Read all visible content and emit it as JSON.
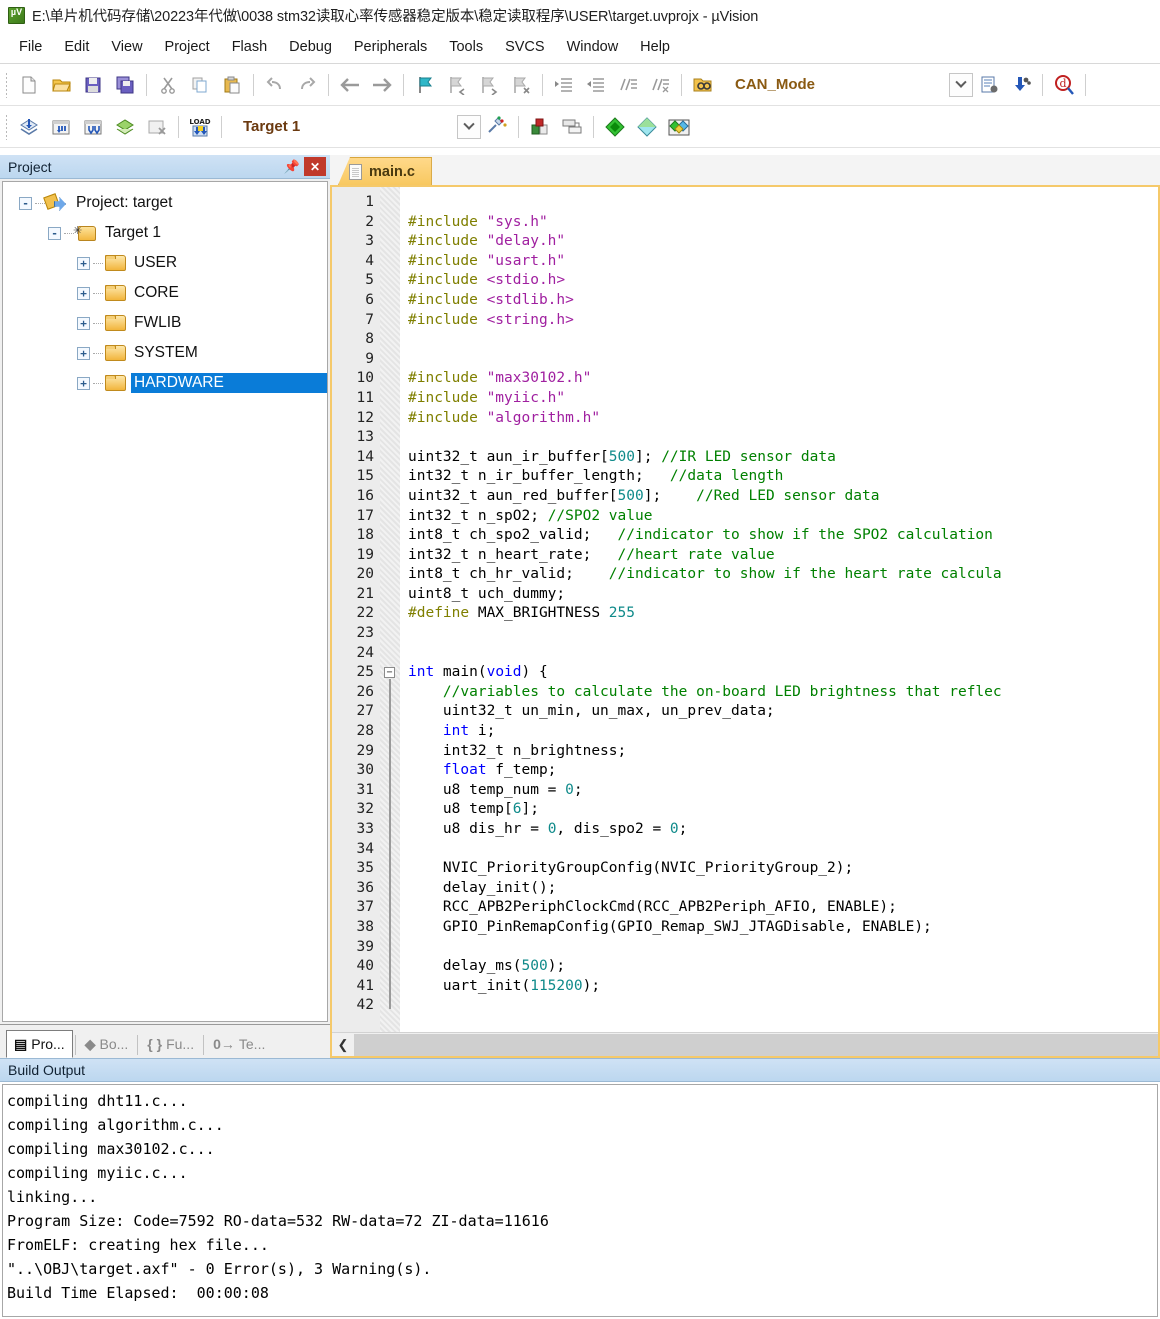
{
  "window": {
    "title": "E:\\单片机代码存储\\20223年代做\\0038 stm32读取心率传感器稳定版本\\稳定读取程序\\USER\\target.uvprojx - µVision",
    "app_icon": "uvision-icon"
  },
  "menu": {
    "items": [
      "File",
      "Edit",
      "View",
      "Project",
      "Flash",
      "Debug",
      "Peripherals",
      "Tools",
      "SVCS",
      "Window",
      "Help"
    ]
  },
  "toolbar1": {
    "buttons": [
      "new-file-icon",
      "open-file-icon",
      "save-icon",
      "save-all-icon",
      "cut-icon",
      "copy-icon",
      "paste-icon",
      "undo-icon",
      "redo-icon",
      "navigate-back-icon",
      "navigate-forward-icon",
      "bookmark-toggle-icon",
      "bookmark-prev-icon",
      "bookmark-next-icon",
      "bookmark-clear-icon",
      "indent-icon",
      "outdent-icon",
      "comment-icon",
      "uncomment-icon",
      "open-folder-icon"
    ],
    "combo_value": "CAN_Mode",
    "right_buttons": [
      "configure-icon",
      "download-icon",
      "find-in-files-icon"
    ]
  },
  "toolbar2": {
    "buttons": [
      "translate-icon",
      "build-icon",
      "rebuild-icon",
      "batch-build-icon",
      "stop-build-icon",
      "load-icon"
    ],
    "combo_value": "Target 1",
    "right_buttons": [
      "target-options-icon",
      "manage-runtime-icon",
      "debug-start-icon",
      "debug-stop-icon",
      "multi-project-icon"
    ]
  },
  "project_panel": {
    "title": "Project",
    "pin_icon": "pin-icon",
    "close_icon": "close-icon",
    "tree": [
      {
        "label": "Project: target",
        "icon": "project-icon",
        "expander": "-",
        "depth": 0,
        "selected": false
      },
      {
        "label": "Target 1",
        "icon": "target-icon",
        "expander": "-",
        "depth": 1,
        "selected": false
      },
      {
        "label": "USER",
        "icon": "folder-icon",
        "expander": "+",
        "depth": 2,
        "selected": false
      },
      {
        "label": "CORE",
        "icon": "folder-icon",
        "expander": "+",
        "depth": 2,
        "selected": false
      },
      {
        "label": "FWLIB",
        "icon": "folder-icon",
        "expander": "+",
        "depth": 2,
        "selected": false
      },
      {
        "label": "SYSTEM",
        "icon": "folder-icon",
        "expander": "+",
        "depth": 2,
        "selected": false
      },
      {
        "label": "HARDWARE",
        "icon": "folder-icon",
        "expander": "+",
        "depth": 2,
        "selected": true
      }
    ],
    "tabs": [
      {
        "glyph": "▤",
        "label": "Pro...",
        "name": "project-tab",
        "active": true
      },
      {
        "glyph": "◆",
        "label": "Bo...",
        "name": "books-tab",
        "active": false
      },
      {
        "glyph": "{ }",
        "label": "Fu...",
        "name": "functions-tab",
        "active": false
      },
      {
        "glyph": "0→",
        "label": "Te...",
        "name": "templates-tab",
        "active": false
      }
    ]
  },
  "editor": {
    "tab_label": "main.c",
    "tab_icon": "c-file-icon",
    "first_line": 1,
    "last_line": 42,
    "fold_marker_line": 25,
    "lines": [
      {
        "n": 1,
        "tokens": []
      },
      {
        "n": 2,
        "tokens": [
          {
            "t": "#include ",
            "c": "k-pre"
          },
          {
            "t": "\"sys.h\"",
            "c": "k-str"
          }
        ]
      },
      {
        "n": 3,
        "tokens": [
          {
            "t": "#include ",
            "c": "k-pre"
          },
          {
            "t": "\"delay.h\"",
            "c": "k-str"
          }
        ]
      },
      {
        "n": 4,
        "tokens": [
          {
            "t": "#include ",
            "c": "k-pre"
          },
          {
            "t": "\"usart.h\"",
            "c": "k-str"
          }
        ]
      },
      {
        "n": 5,
        "tokens": [
          {
            "t": "#include ",
            "c": "k-pre"
          },
          {
            "t": "<stdio.h>",
            "c": "k-str"
          }
        ]
      },
      {
        "n": 6,
        "tokens": [
          {
            "t": "#include ",
            "c": "k-pre"
          },
          {
            "t": "<stdlib.h>",
            "c": "k-str"
          }
        ]
      },
      {
        "n": 7,
        "tokens": [
          {
            "t": "#include ",
            "c": "k-pre"
          },
          {
            "t": "<string.h>",
            "c": "k-str"
          }
        ]
      },
      {
        "n": 8,
        "tokens": []
      },
      {
        "n": 9,
        "tokens": []
      },
      {
        "n": 10,
        "tokens": [
          {
            "t": "#include ",
            "c": "k-pre"
          },
          {
            "t": "\"max30102.h\"",
            "c": "k-str"
          }
        ]
      },
      {
        "n": 11,
        "tokens": [
          {
            "t": "#include ",
            "c": "k-pre"
          },
          {
            "t": "\"myiic.h\"",
            "c": "k-str"
          }
        ]
      },
      {
        "n": 12,
        "tokens": [
          {
            "t": "#include ",
            "c": "k-pre"
          },
          {
            "t": "\"algorithm.h\"",
            "c": "k-str"
          }
        ]
      },
      {
        "n": 13,
        "tokens": []
      },
      {
        "n": 14,
        "tokens": [
          {
            "t": "uint32_t aun_ir_buffer[",
            "c": ""
          },
          {
            "t": "500",
            "c": "k-num"
          },
          {
            "t": "]; ",
            "c": ""
          },
          {
            "t": "//IR LED sensor data",
            "c": "k-cmt"
          }
        ]
      },
      {
        "n": 15,
        "tokens": [
          {
            "t": "int32_t n_ir_buffer_length;   ",
            "c": ""
          },
          {
            "t": "//data length",
            "c": "k-cmt"
          }
        ]
      },
      {
        "n": 16,
        "tokens": [
          {
            "t": "uint32_t aun_red_buffer[",
            "c": ""
          },
          {
            "t": "500",
            "c": "k-num"
          },
          {
            "t": "];    ",
            "c": ""
          },
          {
            "t": "//Red LED sensor data",
            "c": "k-cmt"
          }
        ]
      },
      {
        "n": 17,
        "tokens": [
          {
            "t": "int32_t n_spO2; ",
            "c": ""
          },
          {
            "t": "//SPO2 value",
            "c": "k-cmt"
          }
        ]
      },
      {
        "n": 18,
        "tokens": [
          {
            "t": "int8_t ch_spo2_valid;   ",
            "c": ""
          },
          {
            "t": "//indicator to show if the SPO2 calculation ",
            "c": "k-cmt"
          }
        ]
      },
      {
        "n": 19,
        "tokens": [
          {
            "t": "int32_t n_heart_rate;   ",
            "c": ""
          },
          {
            "t": "//heart rate value",
            "c": "k-cmt"
          }
        ]
      },
      {
        "n": 20,
        "tokens": [
          {
            "t": "int8_t ch_hr_valid;    ",
            "c": ""
          },
          {
            "t": "//indicator to show if the heart rate calcula",
            "c": "k-cmt"
          }
        ]
      },
      {
        "n": 21,
        "tokens": [
          {
            "t": "uint8_t uch_dummy;",
            "c": ""
          }
        ]
      },
      {
        "n": 22,
        "tokens": [
          {
            "t": "#define",
            "c": "k-pre"
          },
          {
            "t": " MAX_BRIGHTNESS ",
            "c": ""
          },
          {
            "t": "255",
            "c": "k-num"
          }
        ]
      },
      {
        "n": 23,
        "tokens": []
      },
      {
        "n": 24,
        "tokens": []
      },
      {
        "n": 25,
        "tokens": [
          {
            "t": "int",
            "c": "k-kw"
          },
          {
            "t": " main(",
            "c": ""
          },
          {
            "t": "void",
            "c": "k-kw"
          },
          {
            "t": ") {",
            "c": ""
          }
        ]
      },
      {
        "n": 26,
        "tokens": [
          {
            "t": "    ",
            "c": ""
          },
          {
            "t": "//variables to calculate the on-board LED brightness that reflec",
            "c": "k-cmt"
          }
        ]
      },
      {
        "n": 27,
        "tokens": [
          {
            "t": "    uint32_t un_min, un_max, un_prev_data;",
            "c": ""
          }
        ]
      },
      {
        "n": 28,
        "tokens": [
          {
            "t": "    ",
            "c": ""
          },
          {
            "t": "int",
            "c": "k-kw"
          },
          {
            "t": " i;",
            "c": ""
          }
        ]
      },
      {
        "n": 29,
        "tokens": [
          {
            "t": "    int32_t n_brightness;",
            "c": ""
          }
        ]
      },
      {
        "n": 30,
        "tokens": [
          {
            "t": "    ",
            "c": ""
          },
          {
            "t": "float",
            "c": "k-kw"
          },
          {
            "t": " f_temp;",
            "c": ""
          }
        ]
      },
      {
        "n": 31,
        "tokens": [
          {
            "t": "    u8 temp_num = ",
            "c": ""
          },
          {
            "t": "0",
            "c": "k-num"
          },
          {
            "t": ";",
            "c": ""
          }
        ]
      },
      {
        "n": 32,
        "tokens": [
          {
            "t": "    u8 temp[",
            "c": ""
          },
          {
            "t": "6",
            "c": "k-num"
          },
          {
            "t": "];",
            "c": ""
          }
        ]
      },
      {
        "n": 33,
        "tokens": [
          {
            "t": "    u8 dis_hr = ",
            "c": ""
          },
          {
            "t": "0",
            "c": "k-num"
          },
          {
            "t": ", dis_spo2 = ",
            "c": ""
          },
          {
            "t": "0",
            "c": "k-num"
          },
          {
            "t": ";",
            "c": ""
          }
        ]
      },
      {
        "n": 34,
        "tokens": []
      },
      {
        "n": 35,
        "tokens": [
          {
            "t": "    NVIC_PriorityGroupConfig(NVIC_PriorityGroup_2);",
            "c": ""
          }
        ]
      },
      {
        "n": 36,
        "tokens": [
          {
            "t": "    delay_init();",
            "c": ""
          }
        ]
      },
      {
        "n": 37,
        "tokens": [
          {
            "t": "    RCC_APB2PeriphClockCmd(RCC_APB2Periph_AFIO, ENABLE);",
            "c": ""
          }
        ]
      },
      {
        "n": 38,
        "tokens": [
          {
            "t": "    GPIO_PinRemapConfig(GPIO_Remap_SWJ_JTAGDisable, ENABLE);",
            "c": ""
          }
        ]
      },
      {
        "n": 39,
        "tokens": []
      },
      {
        "n": 40,
        "tokens": [
          {
            "t": "    delay_ms(",
            "c": ""
          },
          {
            "t": "500",
            "c": "k-num"
          },
          {
            "t": ");",
            "c": ""
          }
        ]
      },
      {
        "n": 41,
        "tokens": [
          {
            "t": "    uart_init(",
            "c": ""
          },
          {
            "t": "115200",
            "c": "k-num"
          },
          {
            "t": ");",
            "c": ""
          }
        ]
      },
      {
        "n": 42,
        "tokens": []
      }
    ],
    "hscroll_left_icon": "scroll-left-icon"
  },
  "build_output": {
    "title": "Build Output",
    "lines": [
      "compiling dht11.c...",
      "compiling algorithm.c...",
      "compiling max30102.c...",
      "compiling myiic.c...",
      "linking...",
      "Program Size: Code=7592 RO-data=532 RW-data=72 ZI-data=11616",
      "FromELF: creating hex file...",
      "\"..\\OBJ\\target.axf\" - 0 Error(s), 3 Warning(s).",
      "Build Time Elapsed:  00:00:08"
    ]
  },
  "colors": {
    "accent_blue": "#0a7cd8",
    "tab_orange": "#f8c860",
    "panel_header": "#bcd7ef",
    "comment_green": "#008000",
    "string_purple": "#a020a0",
    "preproc_olive": "#7f7f00",
    "number_teal": "#0f8a8a",
    "keyword_blue": "#0000ff"
  }
}
